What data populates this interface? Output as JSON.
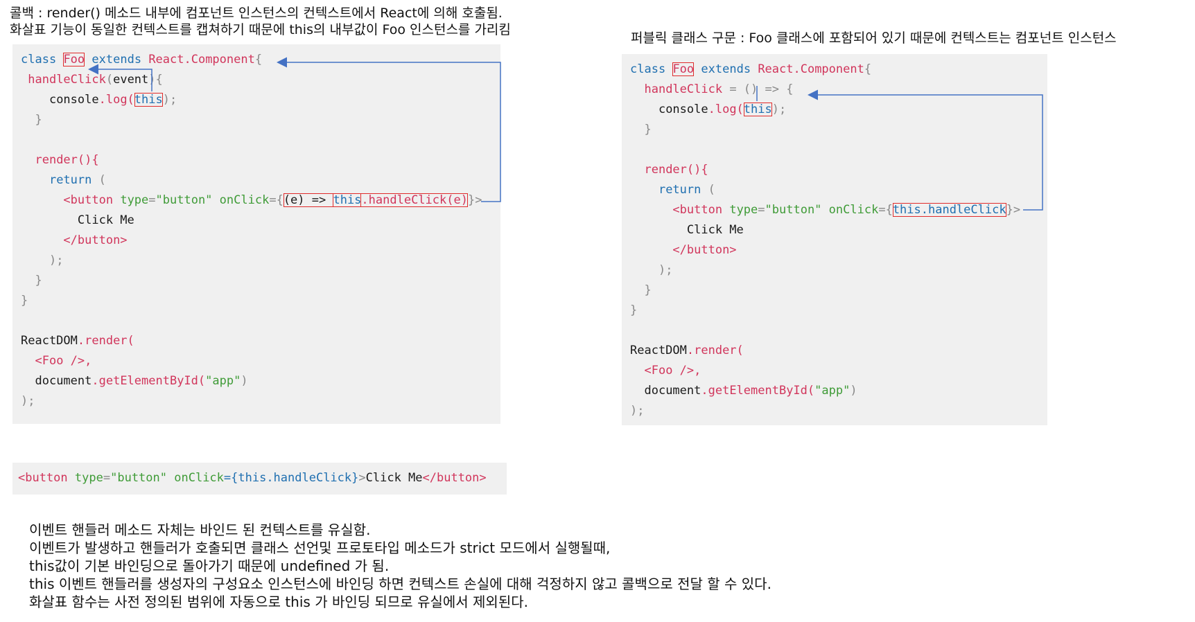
{
  "captions": {
    "left_line1": "콜백 : render() 메소드 내부에 컴포넌트 인스턴스의 컨텍스트에서 React에 의해 호출됨.",
    "left_line2": "화살표 기능이 동일한 컨텍스트를 캡쳐하기 때문에 this의 내부값이 Foo 인스턴스를 가리킴",
    "right_line1": "퍼블릭 클래스 구문 : Foo 클래스에 포함되어 있기 때문에 컨텍스트는 컴포넌트 인스턴스"
  },
  "left_code": {
    "class_kw": "class",
    "class_name": "Foo",
    "extends_kw": "extends",
    "base_class": "React.Component",
    "open_brace": "{",
    "method_name": "handleClick",
    "method_param": "event",
    "method_open": "){",
    "console": "console",
    "log": ".log(",
    "this_kw": "this",
    "log_close": ");",
    "close_brace": "}",
    "render_sig": "render(){",
    "return_kw": "return",
    "return_paren": "(",
    "button_open": "<button",
    "type_attr": "type",
    "type_val": "\"button\"",
    "onclick_attr": "onClick",
    "onclick_open": "={",
    "arrow_expr": "(e) => ",
    "this_call": "this",
    "handle_call": ".handleClick(e)",
    "onclick_close": "}>",
    "button_text": "Click Me",
    "button_close": "</button>",
    "return_close": ");",
    "inner_close": "}",
    "outer_close": "}",
    "reactdom": "ReactDOM",
    "render_call": ".render(",
    "foo_tag": "<Foo />,",
    "document": "document",
    "get_el": ".getElementById(",
    "app_str": "\"app\"",
    "get_close": ")",
    "end": ");"
  },
  "right_code": {
    "class_kw": "class",
    "class_name": "Foo",
    "extends_kw": "extends",
    "base_class": "React.Component",
    "open_brace": "{",
    "method_name": "handleClick",
    "method_eq": " = ",
    "method_parens": "()",
    "method_arrow": " => {",
    "console": "console",
    "log": ".log(",
    "this_kw": "this",
    "log_close": ");",
    "close_brace": "}",
    "render_sig": "render(){",
    "return_kw": "return",
    "return_paren": "(",
    "button_open": "<button",
    "type_attr": "type",
    "type_val": "\"button\"",
    "onclick_attr": "onClick",
    "onclick_open": "={",
    "this_handle": "this.handleClick",
    "onclick_close": "}>",
    "button_text": "Click Me",
    "button_close": "</button>",
    "return_close": ");",
    "inner_close": "}",
    "outer_close": "}",
    "reactdom": "ReactDOM",
    "render_call": ".render(",
    "foo_tag": "<Foo />,",
    "document": "document",
    "get_el": ".getElementById(",
    "app_str": "\"app\"",
    "get_close": ")",
    "end": ");"
  },
  "snippet": {
    "open": "<button",
    "type_attr": "type",
    "type_val": "\"button\"",
    "onclick_attr": "onClick",
    "onclick_val": "={this.handleClick}",
    "gt": ">",
    "text": "Click Me",
    "close": "</button>"
  },
  "notes": [
    "이벤트 핸들러 메소드 자체는 바인드 된 컨텍스트를 유실함.",
    "이벤트가 발생하고 핸들러가 호출되면 클래스 선언및 프로토타입 메소드가 strict 모드에서 실행될때,",
    "this값이 기본 바인딩으로 돌아가기 때문에 undefined 가 됨.",
    "this 이벤트 핸들러를 생성자의 구성요소 인스턴스에 바인딩 하면 컨텍스트 손실에 대해 걱정하지 않고 콜백으로 전달 할 수 있다.",
    "화살표 함수는 사전 정의된 범위에 자동으로 this 가 바인딩 되므로 유실에서 제외된다."
  ],
  "colors": {
    "keyword": "#1f6fb0",
    "name": "#d1355b",
    "string": "#3f9b37",
    "highlight_box": "#e02b2b",
    "arrow": "#4472c4",
    "code_bg": "#f0f0f0"
  }
}
